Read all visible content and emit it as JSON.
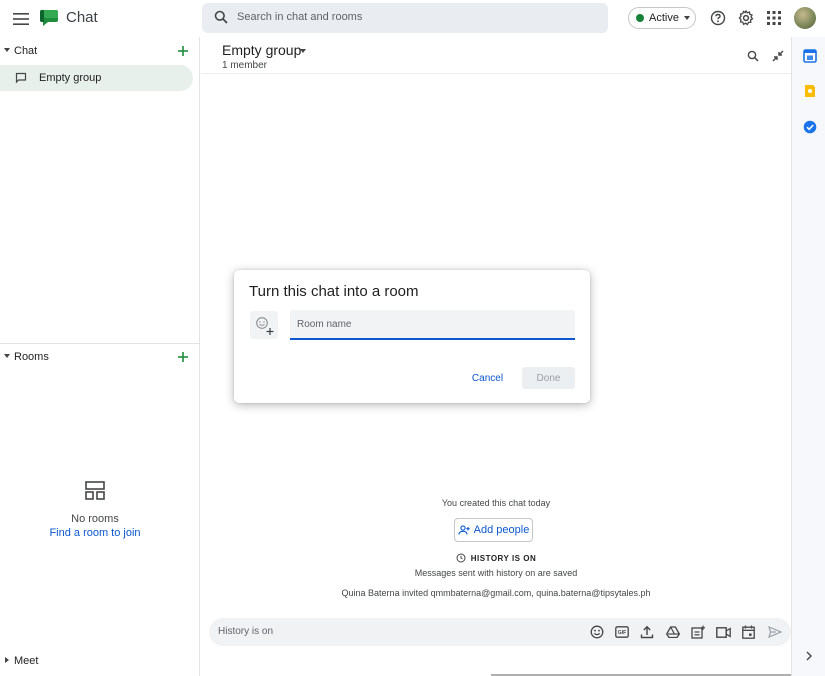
{
  "app": {
    "name": "Chat"
  },
  "search": {
    "placeholder": "Search in chat and rooms"
  },
  "status": {
    "label": "Active",
    "color": "#188038"
  },
  "topbar_icons": [
    "menu-icon",
    "help-icon",
    "gear-icon",
    "apps-grid-icon",
    "avatar"
  ],
  "sidebar": {
    "chat_section": {
      "label": "Chat",
      "items": [
        {
          "label": "Empty group",
          "icon": "chat-bubble-icon"
        }
      ]
    },
    "rooms_section": {
      "label": "Rooms",
      "empty_text": "No rooms",
      "link": "Find a room to join"
    },
    "meet_section": {
      "label": "Meet"
    }
  },
  "main": {
    "title": "Empty group",
    "subtitle": "1 member",
    "created_text": "You created this chat today",
    "add_people_label": "Add people",
    "history_label": "HISTORY IS ON",
    "history_sub": "Messages sent with history on are saved",
    "invite_text": "Quina Baterna invited qmmbaterna@gmail.com, quina.baterna@tipsytales.ph",
    "composer_placeholder": "History is on",
    "composer_icons": [
      "emoji-icon",
      "gif-icon",
      "upload-icon",
      "drive-icon",
      "create-meeting-icon",
      "video-call-icon",
      "calendar-icon",
      "send-icon"
    ]
  },
  "dialog": {
    "title": "Turn this chat into a room",
    "name_placeholder": "Room name",
    "cancel_label": "Cancel",
    "done_label": "Done"
  },
  "rail_icons": [
    "calendar-app-icon",
    "keep-app-icon",
    "tasks-app-icon"
  ],
  "colors": {
    "accent": "#0b57d0",
    "green": "#1e8e3e",
    "selected_bg": "#e8f0eb"
  }
}
